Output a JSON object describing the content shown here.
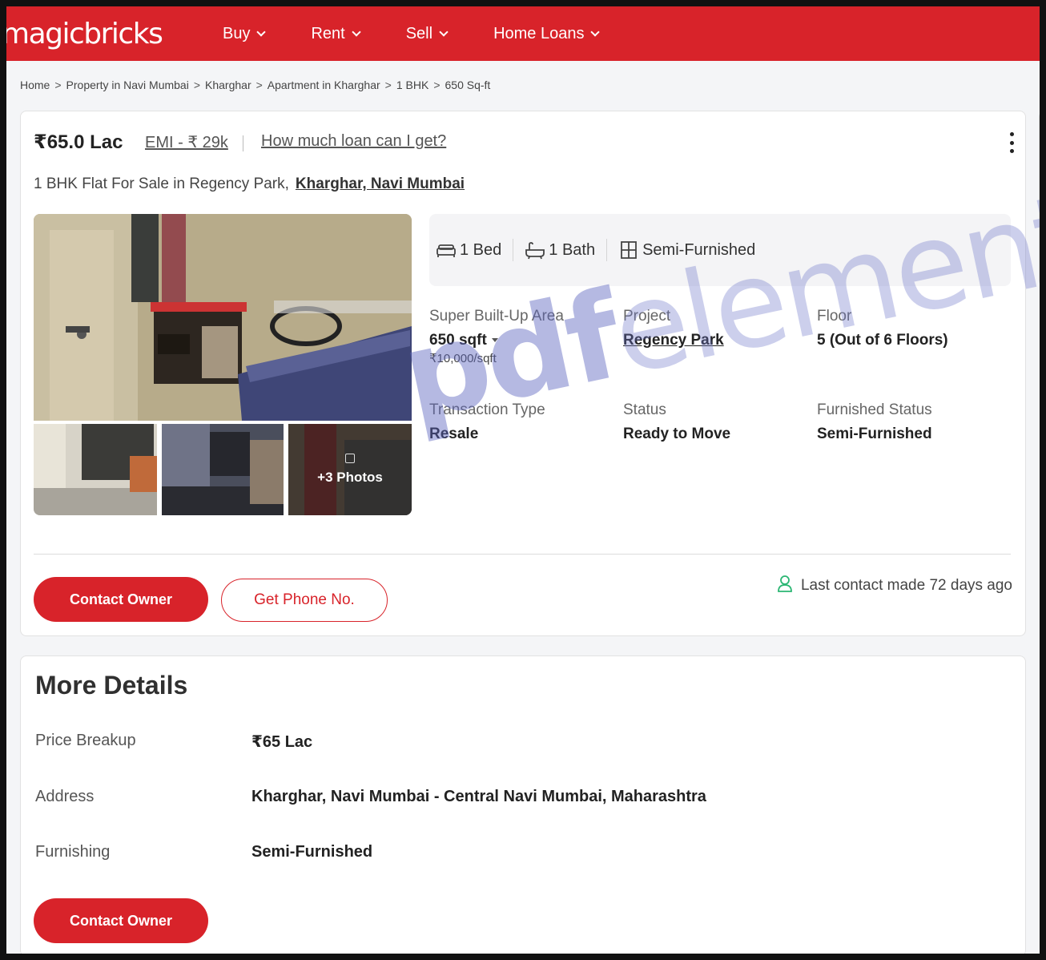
{
  "nav": {
    "logo": "magicbricks",
    "items": [
      {
        "label": "Buy"
      },
      {
        "label": "Rent"
      },
      {
        "label": "Sell"
      },
      {
        "label": "Home Loans"
      }
    ]
  },
  "breadcrumb": [
    "Home",
    "Property in Navi Mumbai",
    "Kharghar",
    "Apartment in Kharghar",
    "1 BHK",
    "650 Sq-ft"
  ],
  "listing": {
    "price": "₹65.0 Lac",
    "emi": "EMI - ₹ 29k",
    "loan_link": "How much loan can I get?",
    "title_prefix": "1 BHK Flat For Sale in Regency Park,",
    "title_location": "Kharghar, Navi Mumbai",
    "more_photos": "+3 Photos",
    "summary": {
      "bed": "1 Bed",
      "bath": "1 Bath",
      "furnishing": "Semi-Furnished"
    },
    "facts": {
      "area_label": "Super Built-Up Area",
      "area_value": "650 sqft",
      "area_rate": "₹10,000/sqft",
      "project_label": "Project",
      "project_value": "Regency Park",
      "floor_label": "Floor",
      "floor_value": "5 (Out of 6 Floors)",
      "transaction_label": "Transaction Type",
      "transaction_value": "Resale",
      "status_label": "Status",
      "status_value": "Ready to Move",
      "furnished_label": "Furnished Status",
      "furnished_value": "Semi-Furnished"
    },
    "contact_owner": "Contact Owner",
    "get_phone": "Get Phone No.",
    "last_contact": "Last contact made 72 days ago"
  },
  "more_details": {
    "title": "More Details",
    "rows": [
      {
        "key": "Price Breakup",
        "value": "₹65 Lac"
      },
      {
        "key": "Address",
        "value": "Kharghar, Navi Mumbai - Central Navi Mumbai, Maharashtra"
      },
      {
        "key": "Furnishing",
        "value": "Semi-Furnished"
      }
    ],
    "contact_owner": "Contact Owner"
  },
  "watermark": {
    "bold": "pdf",
    "rest": "element"
  },
  "colors": {
    "brand_red": "#d8232a",
    "accent_green": "#2bb673"
  }
}
